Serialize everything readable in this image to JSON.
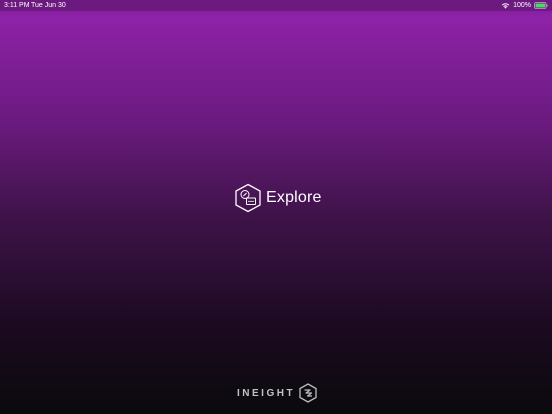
{
  "status_bar": {
    "time": "3:11 PM",
    "date": "Tue Jun 30",
    "battery_percent": "100%",
    "battery_level": 1.0,
    "icons": [
      "wifi-icon",
      "battery-icon"
    ]
  },
  "splash": {
    "app_name": "Explore",
    "icon": "explore-hex-icon"
  },
  "footer": {
    "brand": "INEIGHT",
    "icon": "ineight-logo-icon"
  },
  "colors": {
    "top": "#8e22a8",
    "bottom": "#0a0a0c",
    "status_bar": "#6c1a7f",
    "text": "#ffffff",
    "battery": "#4cd964"
  }
}
